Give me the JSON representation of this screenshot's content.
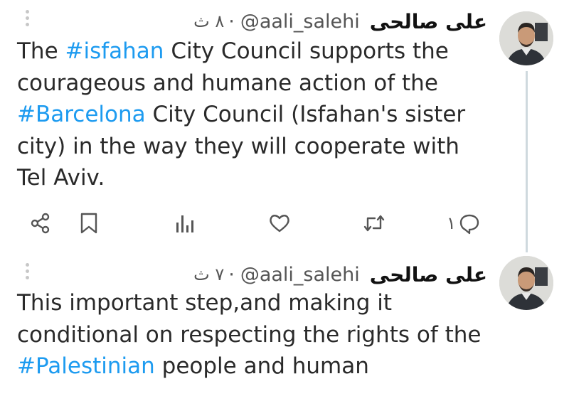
{
  "tweets": [
    {
      "author": {
        "name": "علی صالحی",
        "handle": "@aali_salehi"
      },
      "separator": "·",
      "time": "۸ ث",
      "lines": [
        [
          {
            "t": "The "
          },
          {
            "t": "#isfahan",
            "tag": true
          },
          {
            "t": " City Council supports the"
          }
        ],
        [
          {
            "t": "courageous and humane action of the"
          }
        ],
        [
          {
            "t": "#Barcelona",
            "tag": true
          },
          {
            "t": " City Council (Isfahan's sister"
          }
        ],
        [
          {
            "t": "city) in the way they will cooperate with"
          }
        ],
        [
          {
            "t": "Tel Aviv."
          }
        ]
      ],
      "actions": {
        "reply_count": "۱"
      }
    },
    {
      "author": {
        "name": "علی صالحی",
        "handle": "@aali_salehi"
      },
      "separator": "·",
      "time": "۷ ث",
      "lines": [
        [
          {
            "t": "This important step,and making it"
          }
        ],
        [
          {
            "t": "conditional on respecting the rights of the"
          }
        ],
        [
          {
            "t": "#Palestinian",
            "tag": true
          },
          {
            "t": " people and human"
          }
        ]
      ]
    }
  ],
  "colors": {
    "hashtag": "#1d9bf0",
    "text": "#2a2a2a",
    "muted": "#555555",
    "thread_line": "#cfd9de"
  },
  "icons": [
    "share-icon",
    "bookmark-icon",
    "views-icon",
    "like-icon",
    "retweet-icon",
    "reply-icon",
    "more-icon"
  ]
}
